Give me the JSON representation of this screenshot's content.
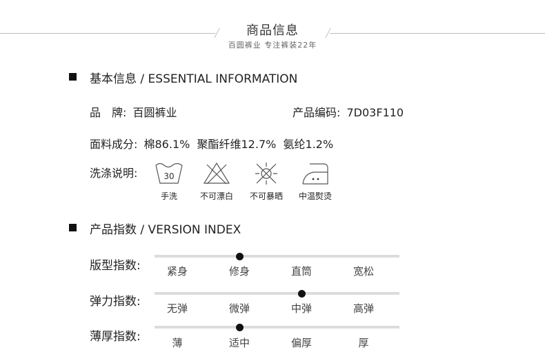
{
  "header": {
    "title": "商品信息",
    "subtitle": "百圆裤业 专注裤装22年"
  },
  "basic": {
    "heading": "基本信息 / ESSENTIAL INFORMATION",
    "brand_label": "品　牌:",
    "brand_value": "百圆裤业",
    "code_label": "产品编码:",
    "code_value": "7D03F110",
    "material_label": "面料成分:",
    "material_value": "棉86.1%  聚酯纤维12.7%  氨纶1.2%",
    "wash_label": "洗涤说明:",
    "care": [
      {
        "icon": "hand-wash-30-icon",
        "text": "30",
        "label": "手洗"
      },
      {
        "icon": "no-bleach-icon",
        "label": "不可漂白"
      },
      {
        "icon": "no-sun-dry-icon",
        "label": "不可暴晒"
      },
      {
        "icon": "iron-medium-icon",
        "label": "中温熨烫"
      }
    ]
  },
  "version": {
    "heading": "产品指数 / VERSION INDEX",
    "indexes": [
      {
        "label": "版型指数:",
        "options": [
          "紧身",
          "修身",
          "直筒",
          "宽松"
        ],
        "selected_index": 1
      },
      {
        "label": "弹力指数:",
        "options": [
          "无弹",
          "微弹",
          "中弹",
          "高弹"
        ],
        "selected_index": 2
      },
      {
        "label": "薄厚指数:",
        "options": [
          "薄",
          "适中",
          "偏厚",
          "厚"
        ],
        "selected_index": 1
      }
    ]
  }
}
